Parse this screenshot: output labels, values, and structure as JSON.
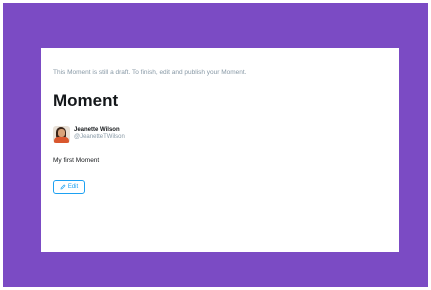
{
  "colors": {
    "frame": "#7b4bc4",
    "card": "#ffffff",
    "accent": "#1da1f2",
    "muted_text": "#8899a6",
    "primary_text": "#14171a"
  },
  "notice": {
    "text": "This Moment is still a draft. To finish, edit and publish your Moment."
  },
  "moment": {
    "title": "Moment",
    "description": "My first Moment"
  },
  "author": {
    "name": "Jeanette Wilson",
    "handle": "@JeanetteTWilson",
    "avatar_icon": "avatar-photo"
  },
  "actions": {
    "edit_label": "Edit",
    "edit_icon": "pencil-icon"
  }
}
